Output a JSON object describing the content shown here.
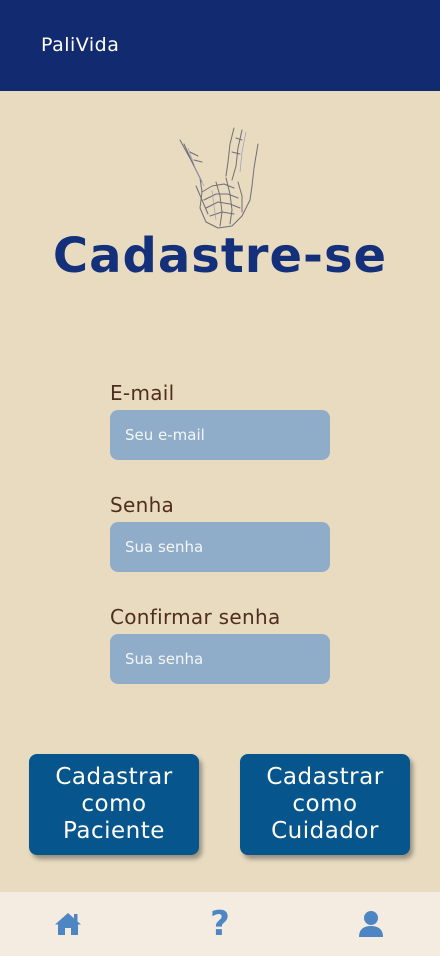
{
  "header": {
    "app_name": "PaliVida"
  },
  "page": {
    "title": "Cadastre-se"
  },
  "form": {
    "email_label": "E-mail",
    "email_placeholder": "Seu e-mail",
    "password_label": "Senha",
    "password_placeholder": "Sua senha",
    "confirm_label": "Confirmar senha",
    "confirm_placeholder": "Sua senha"
  },
  "actions": {
    "patient_label": "Cadastrar\ncomo\nPaciente",
    "caregiver_label": "Cadastrar\ncomo\nCuidador"
  },
  "nav": {
    "items": [
      {
        "icon": "home-icon"
      },
      {
        "icon": "help-icon"
      },
      {
        "icon": "user-icon"
      }
    ],
    "help_glyph": "?"
  },
  "colors": {
    "header": "#112a70",
    "background": "#e8dbc0",
    "title": "#14307a",
    "label": "#4f2e1f",
    "input": "#8fadc8",
    "button": "#06558c",
    "nav_bg": "#f4ece0",
    "nav_icon": "#4e86c4"
  }
}
